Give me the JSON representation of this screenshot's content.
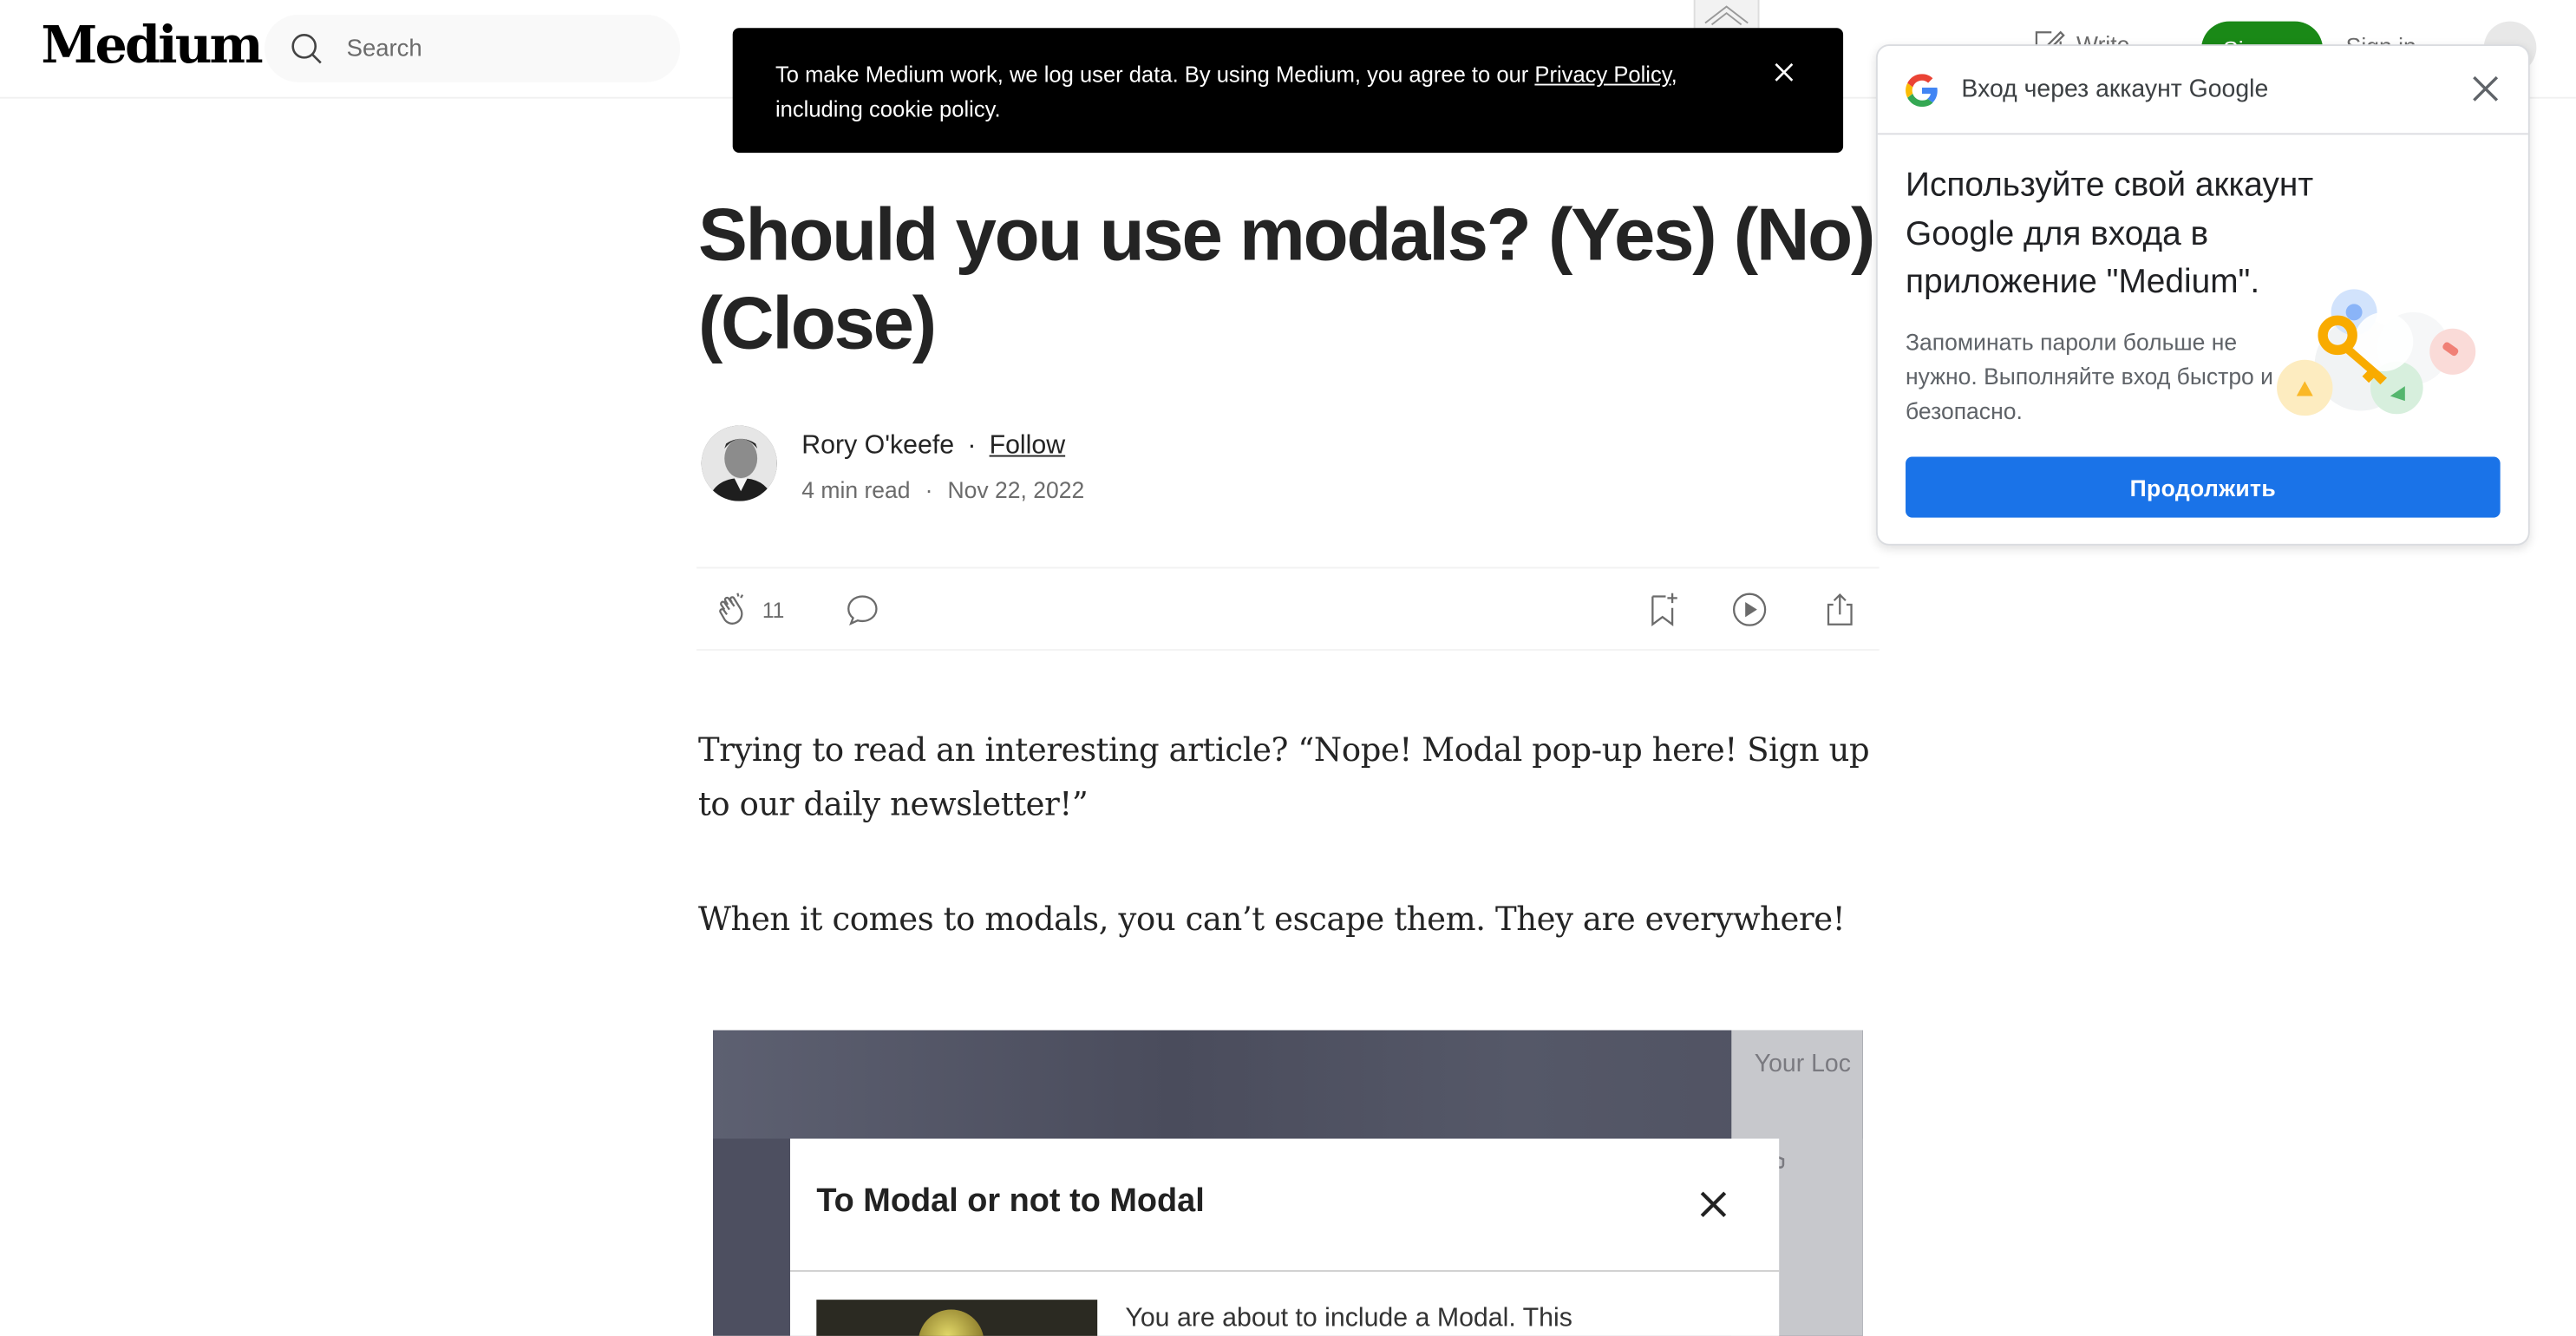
{
  "header": {
    "logo": "Medium",
    "search_placeholder": "Search",
    "write_label": "Write",
    "signup_label": "Sign up",
    "signin_label": "Sign in"
  },
  "cookie_banner": {
    "text_before": "To make Medium work, we log user data. By using Medium, you agree to our ",
    "link_text": "Privacy Policy",
    "text_after": ", including cookie policy."
  },
  "article": {
    "title": "Should you use modals? (Yes) (No) (Close)",
    "author": "Rory O'keefe",
    "separator": "·",
    "follow_label": "Follow",
    "read_time": "4 min read",
    "date": "Nov 22, 2022",
    "clap_count": "11",
    "paragraphs": [
      "Trying to read an interesting article? “Nope! Modal pop-up here! Sign up to our daily newsletter!”",
      "When it comes to modals, you can’t escape them. They are everywhere!"
    ]
  },
  "figure": {
    "modal_title": "To Modal or not to Modal",
    "modal_body": "You are about to include a Modal. This",
    "side_text": "Your Loc"
  },
  "google_panel": {
    "header_title": "Вход через аккаунт Google",
    "heading": "Используйте свой аккаунт Google для входа в приложение \"Medium\".",
    "description": "Запоминать пароли больше не нужно. Выполняйте вход быстро и безопасно.",
    "continue_label": "Продолжить"
  },
  "colors": {
    "signup_green": "#1a8917",
    "google_blue": "#1a73e8",
    "cookie_bg": "#000000",
    "text": "#242424"
  },
  "icons": [
    "search-icon",
    "write-icon",
    "close-icon",
    "clap-icon",
    "comment-icon",
    "bookmark-icon",
    "play-icon",
    "share-icon",
    "google-logo-icon",
    "key-illustration"
  ]
}
